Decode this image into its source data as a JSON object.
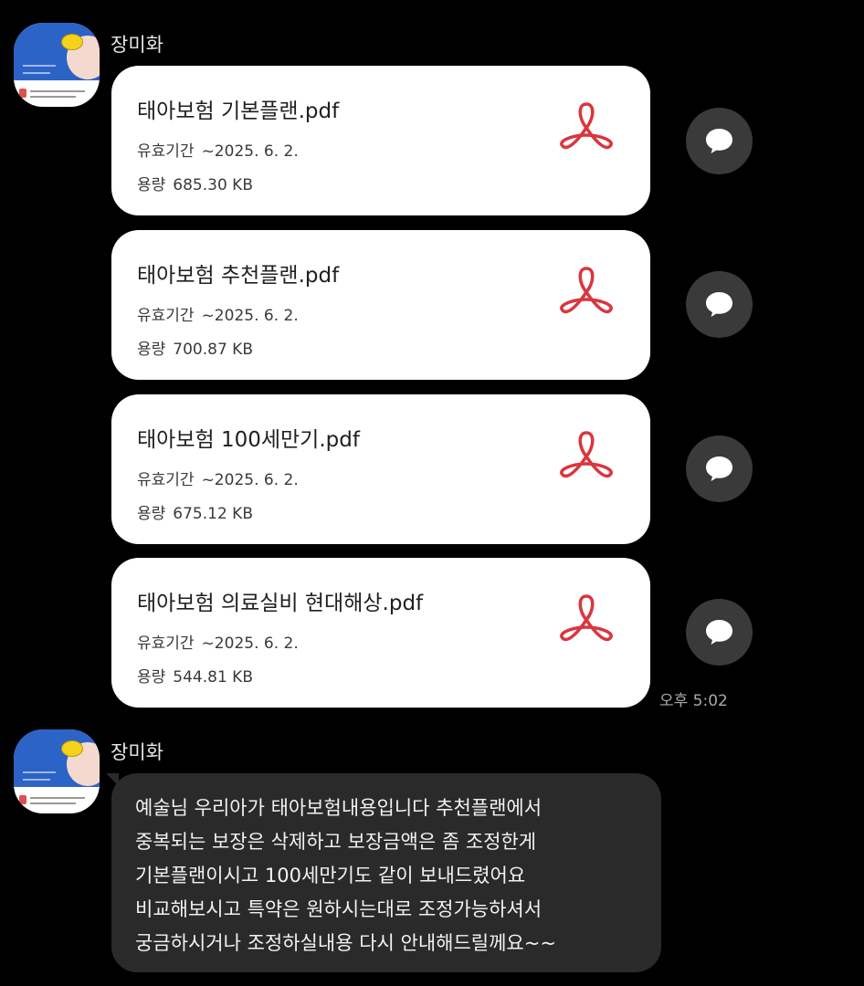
{
  "group1": {
    "sender_name": "장미화",
    "files": [
      {
        "name": "태아보험 기본플랜.pdf",
        "expiry_label": "유효기간",
        "expiry_value": "~2025. 6. 2.",
        "size_label": "용량",
        "size_value": "685.30 KB"
      },
      {
        "name": "태아보험 추천플랜.pdf",
        "expiry_label": "유효기간",
        "expiry_value": "~2025. 6. 2.",
        "size_label": "용량",
        "size_value": "700.87 KB"
      },
      {
        "name": "태아보험 100세만기.pdf",
        "expiry_label": "유효기간",
        "expiry_value": "~2025. 6. 2.",
        "size_label": "용량",
        "size_value": "675.12 KB"
      },
      {
        "name": "태아보험 의료실비 현대해상.pdf",
        "expiry_label": "유효기간",
        "expiry_value": "~2025. 6. 2.",
        "size_label": "용량",
        "size_value": "544.81 KB"
      }
    ],
    "timestamp": "오후 5:02"
  },
  "group2": {
    "sender_name": "장미화",
    "message_lines": [
      "예술님 우리아가 태아보험내용입니다 추천플랜에서",
      "중복되는 보장은 삭제하고 보장금액은 좀 조정한게",
      "기본플랜이시고 100세만기도 같이 보내드렸어요",
      "비교해보시고 특약은 원하시는대로 조정가능하셔서",
      "궁금하시거나 조정하실내용 다시 안내해드릴께요~~"
    ]
  },
  "icons": {
    "file_icon": "pdf-acrobat-icon",
    "share_icon": "speech-bubble-icon"
  },
  "colors": {
    "background": "#000000",
    "pdf_red": "#d9363e",
    "share_button": "#3a3a3a",
    "text_bubble": "#2a2a2a"
  }
}
